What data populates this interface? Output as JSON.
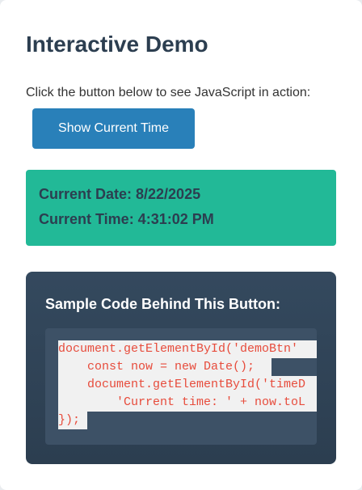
{
  "page": {
    "title": "Interactive Demo",
    "instructions": "Click the button below to see JavaScript in action:",
    "button_label": "Show Current Time"
  },
  "result": {
    "date_line": "Current Date: 8/22/2025",
    "time_line": "Current Time: 4:31:02 PM"
  },
  "code": {
    "title": "Sample Code Behind This Button:",
    "lines": [
      "document.getElementById('demoBtn'",
      "    const now = new Date();",
      "    document.getElementById('timeD",
      "        'Current time: ' + now.toL",
      "});"
    ]
  },
  "colors": {
    "heading": "#2c3e50",
    "button": "#2980b9",
    "result_background": "#22b997",
    "code_panel": "#2c3e50",
    "code_text": "#e74c3c"
  }
}
